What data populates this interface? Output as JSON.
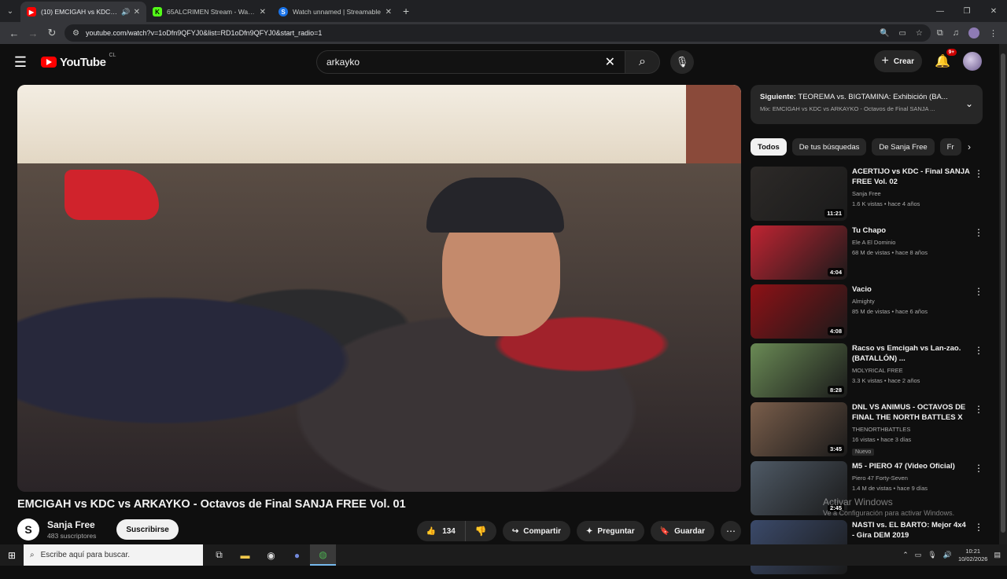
{
  "browser": {
    "tabs": [
      {
        "title": "(10) EMCIGAH vs KDC vs AR",
        "active": true
      },
      {
        "title": "65ALCRIMEN Stream - Watch L",
        "active": false
      },
      {
        "title": "Watch unnamed | Streamable",
        "active": false
      }
    ],
    "url": "youtube.com/watch?v=1oDfn9QFYJ0&list=RD1oDfn9QFYJ0&start_radio=1"
  },
  "header": {
    "logo_text": "YouTube",
    "country": "CL",
    "search_value": "arkayko",
    "create_label": "Crear",
    "notif_badge": "9+"
  },
  "video": {
    "title": "EMCIGAH vs KDC vs ARKAYKO - Octavos de Final SANJA FREE Vol. 01",
    "channel": "Sanja Free",
    "subscribers": "483 suscriptores",
    "subscribe_label": "Suscribirse",
    "likes": "134",
    "share_label": "Compartir",
    "ask_label": "Preguntar",
    "save_label": "Guardar"
  },
  "sidebar": {
    "next_up_prefix": "Siguiente:",
    "next_up_title": "TEOREMA vs. BIGTAMINA: Exhibición (BA...",
    "next_up_mix": "Mix: EMCIGAH vs KDC vs ARKAYKO - Octavos de Final SANJA ...",
    "chips": [
      "Todos",
      "De tus búsquedas",
      "De Sanja Free",
      "Fr"
    ],
    "recommendations": [
      {
        "title": "ACERTIJO vs KDC - Final SANJA FREE Vol. 02",
        "channel": "Sanja Free",
        "meta": "1.6 K vistas • hace 4 años",
        "duration": "11:21",
        "badge": "",
        "thumb_color": "#2d2a28"
      },
      {
        "title": "Tu Chapo",
        "channel": "Ele A El Dominio",
        "meta": "68 M de vistas • hace 8 años",
        "duration": "4:04",
        "badge": "",
        "thumb_color": "#c02432"
      },
      {
        "title": "Vacio",
        "channel": "Almighty",
        "meta": "85 M de vistas • hace 6 años",
        "duration": "4:08",
        "badge": "",
        "thumb_color": "#8e1116"
      },
      {
        "title": "Racso vs Emcigah vs Lan-zao. (BATALLÓN) ...",
        "channel": "MOLYRICAL FREE",
        "meta": "3.3 K vistas • hace 2 años",
        "duration": "8:28",
        "badge": "",
        "thumb_color": "#6a8a55"
      },
      {
        "title": "DNL VS ANIMUS - OCTAVOS DE FINAL THE NORTH BATTLES X ...",
        "channel": "THENORTHBATTLES",
        "meta": "16 vistas • hace 3 días",
        "duration": "3:45",
        "badge": "Nuevo",
        "thumb_color": "#7a5e4b"
      },
      {
        "title": "M5 - PIERO 47 (Video Oficial)",
        "channel": "Piero 47 Forty-Seven",
        "meta": "1.4 M de vistas • hace 9 días",
        "duration": "2:45",
        "badge": "",
        "thumb_color": "#4f5a66"
      },
      {
        "title": "NASTI vs. EL BARTO: Mejor 4x4 - Gira DEM 2019",
        "channel": "",
        "meta": "",
        "duration": "",
        "badge": "",
        "thumb_color": "#3b4a6a"
      }
    ]
  },
  "watermark": {
    "line1": "Activar Windows",
    "line2": "Ve a Configuración para activar Windows."
  },
  "taskbar": {
    "search_placeholder": "Escribe aquí para buscar.",
    "time": "10:21",
    "date": "10/02/2026"
  }
}
